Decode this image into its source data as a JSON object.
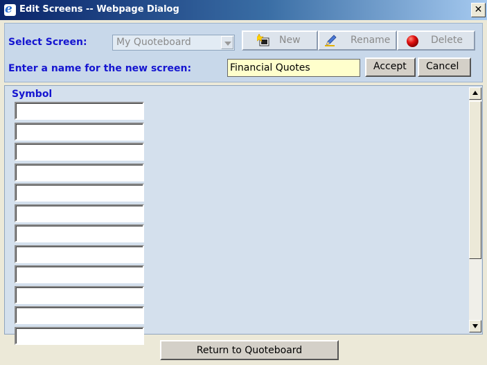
{
  "window": {
    "title": "Edit Screens -- Webpage Dialog",
    "close_glyph": "✕"
  },
  "header": {
    "select_label": "Select Screen:",
    "select_value": "My Quoteboard",
    "buttons": {
      "new": "New",
      "rename": "Rename",
      "delete": "Delete"
    },
    "name_label": "Enter a name for the new screen:",
    "name_value": "Financial Quotes",
    "accept": "Accept",
    "cancel": "Cancel"
  },
  "content": {
    "column_header": "Symbol",
    "symbol_rows": [
      "",
      "",
      "",
      "",
      "",
      "",
      "",
      "",
      "",
      "",
      "",
      ""
    ]
  },
  "footer": {
    "return_label": "Return to Quoteboard"
  },
  "colors": {
    "accent_label": "#1515d0",
    "panel_bg": "#c8d8ea",
    "input_highlight": "#ffffcc"
  }
}
